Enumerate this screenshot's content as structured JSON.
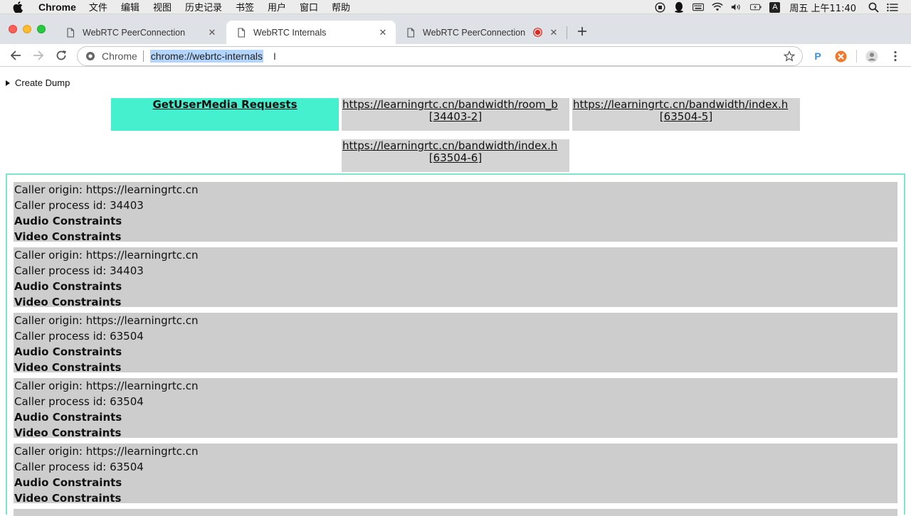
{
  "menubar": {
    "app_name": "Chrome",
    "items": [
      "文件",
      "编辑",
      "视图",
      "历史记录",
      "书签",
      "用户",
      "窗口",
      "帮助"
    ],
    "clock": "周五 上午11:40",
    "icons": [
      "record-icon",
      "qq-icon",
      "keyboard-icon",
      "wifi-icon",
      "volume-icon",
      "battery-icon",
      "input-method-icon",
      "spotlight-icon",
      "list-icon"
    ],
    "input_method_label": "A"
  },
  "tabs": [
    {
      "title": "WebRTC PeerConnection",
      "active": false,
      "recording": false
    },
    {
      "title": "WebRTC Internals",
      "active": true,
      "recording": false
    },
    {
      "title": "WebRTC PeerConnection",
      "active": false,
      "recording": true
    }
  ],
  "omnibox": {
    "scheme_label": "Chrome",
    "url": "chrome://webrtc-internals"
  },
  "extensions": {
    "p_label": "P"
  },
  "page": {
    "create_dump": "Create Dump",
    "tab_headers": [
      {
        "line1": "GetUserMedia Requests",
        "line2": "",
        "selected": true
      },
      {
        "line1": "https://learningrtc.cn/bandwidth/room_b",
        "line2": "[34403-2]",
        "selected": false
      },
      {
        "line1": "https://learningrtc.cn/bandwidth/index.h",
        "line2": "[63504-5]",
        "selected": false
      },
      {
        "line1": "https://learningrtc.cn/bandwidth/index.h",
        "line2": "[63504-6]",
        "selected": false
      }
    ],
    "requests": [
      {
        "origin": "Caller origin: https://learningrtc.cn",
        "pid": "Caller process id: 34403",
        "audio": "Audio Constraints",
        "video": "Video Constraints"
      },
      {
        "origin": "Caller origin: https://learningrtc.cn",
        "pid": "Caller process id: 34403",
        "audio": "Audio Constraints",
        "video": "Video Constraints"
      },
      {
        "origin": "Caller origin: https://learningrtc.cn",
        "pid": "Caller process id: 63504",
        "audio": "Audio Constraints",
        "video": "Video Constraints"
      },
      {
        "origin": "Caller origin: https://learningrtc.cn",
        "pid": "Caller process id: 63504",
        "audio": "Audio Constraints",
        "video": "Video Constraints"
      },
      {
        "origin": "Caller origin: https://learningrtc.cn",
        "pid": "Caller process id: 63504",
        "audio": "Audio Constraints",
        "video": "Video Constraints"
      }
    ]
  },
  "colors": {
    "selected_tab": "#44f0cd",
    "panel_border": "#7de6cf",
    "request_bg": "#cdcdcd",
    "record_dot": "#e0271f"
  }
}
